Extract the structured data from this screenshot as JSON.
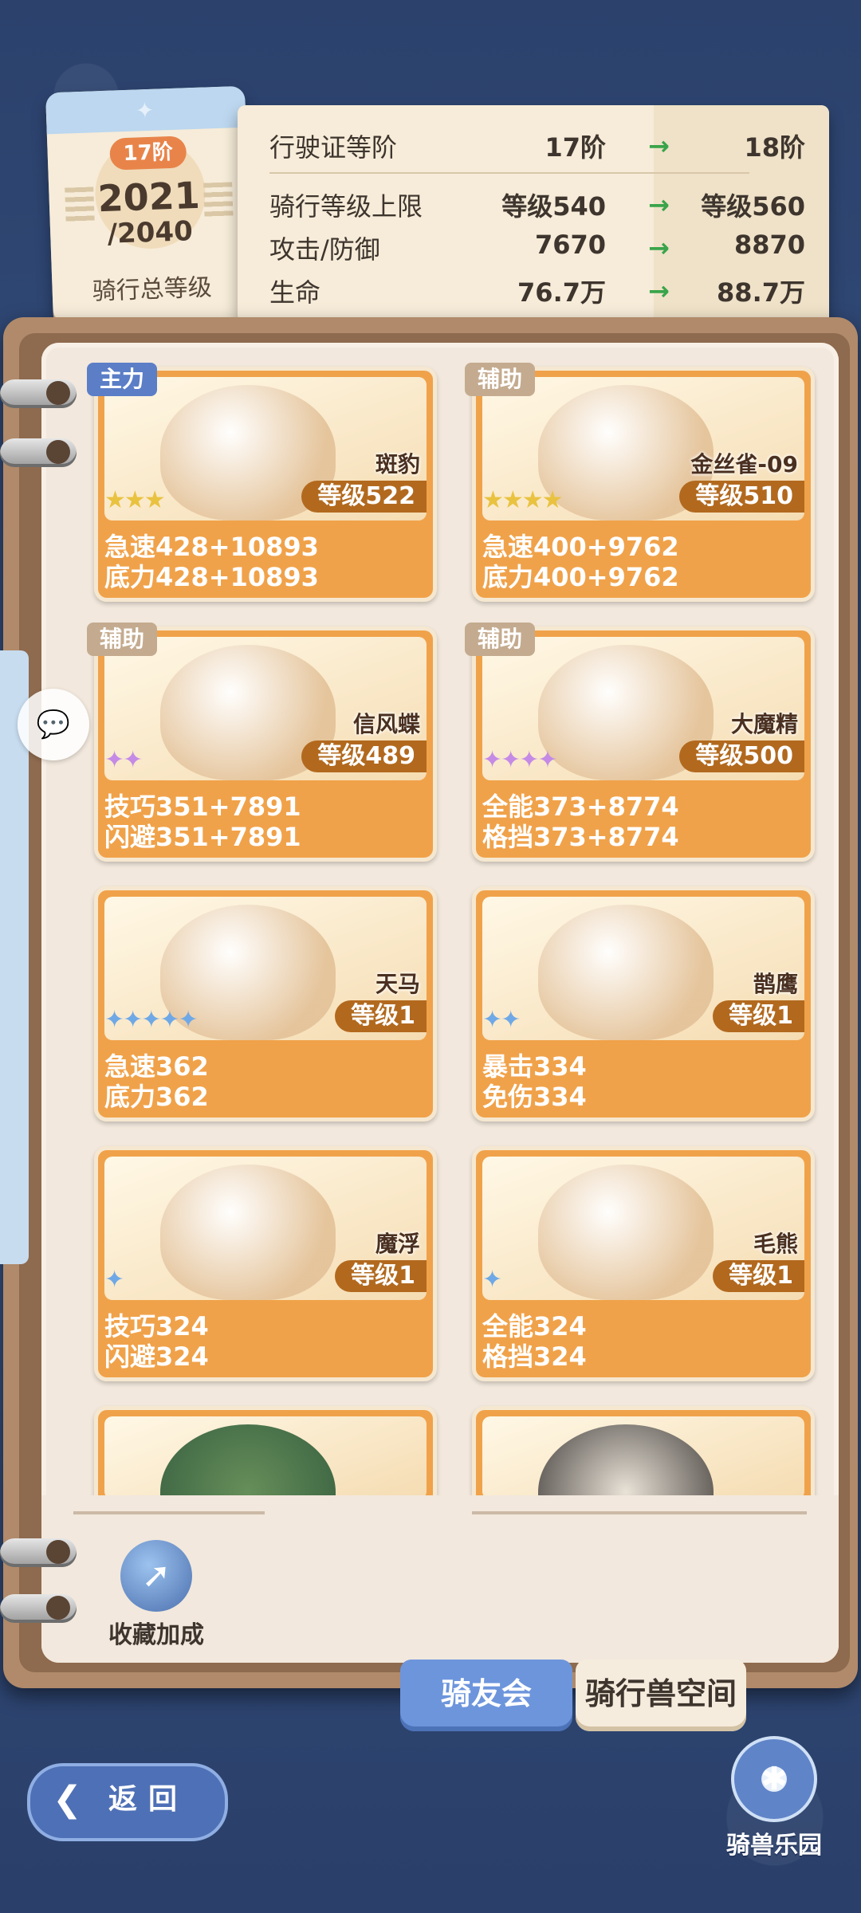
{
  "summary": {
    "stage_badge": "17阶",
    "total_level": "2021",
    "max_level": "/2040",
    "caption": "骑行总等级"
  },
  "stats": [
    {
      "label": "行驶证等阶",
      "current": "17阶",
      "next": "18阶"
    },
    {
      "label": "骑行等级上限",
      "current": "等级540",
      "next": "等级560"
    },
    {
      "label": "攻击/防御",
      "current": "7670",
      "next": "8870"
    },
    {
      "label": "生命",
      "current": "76.7万",
      "next": "88.7万"
    }
  ],
  "mounts": [
    {
      "role": "主力",
      "name": "斑豹",
      "level": "等级522",
      "stars": "★★★",
      "star_color": "#e9c240",
      "stat1": "急速428+10893",
      "stat2": "底力428+10893"
    },
    {
      "role": "辅助",
      "name": "金丝雀-09",
      "level": "等级510",
      "stars": "★★★★",
      "star_color": "#e9c240",
      "stat1": "急速400+9762",
      "stat2": "底力400+9762"
    },
    {
      "role": "辅助",
      "name": "信风蝶",
      "level": "等级489",
      "stars": "✦✦",
      "star_color": "#c58ae6",
      "stat1": "技巧351+7891",
      "stat2": "闪避351+7891"
    },
    {
      "role": "辅助",
      "name": "大魔精",
      "level": "等级500",
      "stars": "✦✦✦✦",
      "star_color": "#c58ae6",
      "stat1": "全能373+8774",
      "stat2": "格挡373+8774"
    },
    {
      "role": "",
      "name": "天马",
      "level": "等级1",
      "stars": "✦✦✦✦✦",
      "star_color": "#6fa8e6",
      "stat1": "急速362",
      "stat2": "底力362"
    },
    {
      "role": "",
      "name": "鹊鹰",
      "level": "等级1",
      "stars": "✦✦",
      "star_color": "#6fa8e6",
      "stat1": "暴击334",
      "stat2": "免伤334"
    },
    {
      "role": "",
      "name": "魔浮",
      "level": "等级1",
      "stars": "✦",
      "star_color": "#6fa8e6",
      "stat1": "技巧324",
      "stat2": "闪避324"
    },
    {
      "role": "",
      "name": "毛熊",
      "level": "等级1",
      "stars": "✦",
      "star_color": "#6fa8e6",
      "stat1": "全能324",
      "stat2": "格挡324"
    }
  ],
  "collect_label": "收藏加成",
  "tabs": {
    "active": "骑友会",
    "inactive": "骑行兽空间"
  },
  "back_label": "返回",
  "park_label": "骑兽乐园",
  "icons": {
    "arrow": "→",
    "back": "❮",
    "chat": "💬",
    "rocket": "➚",
    "wheel": "✱"
  }
}
